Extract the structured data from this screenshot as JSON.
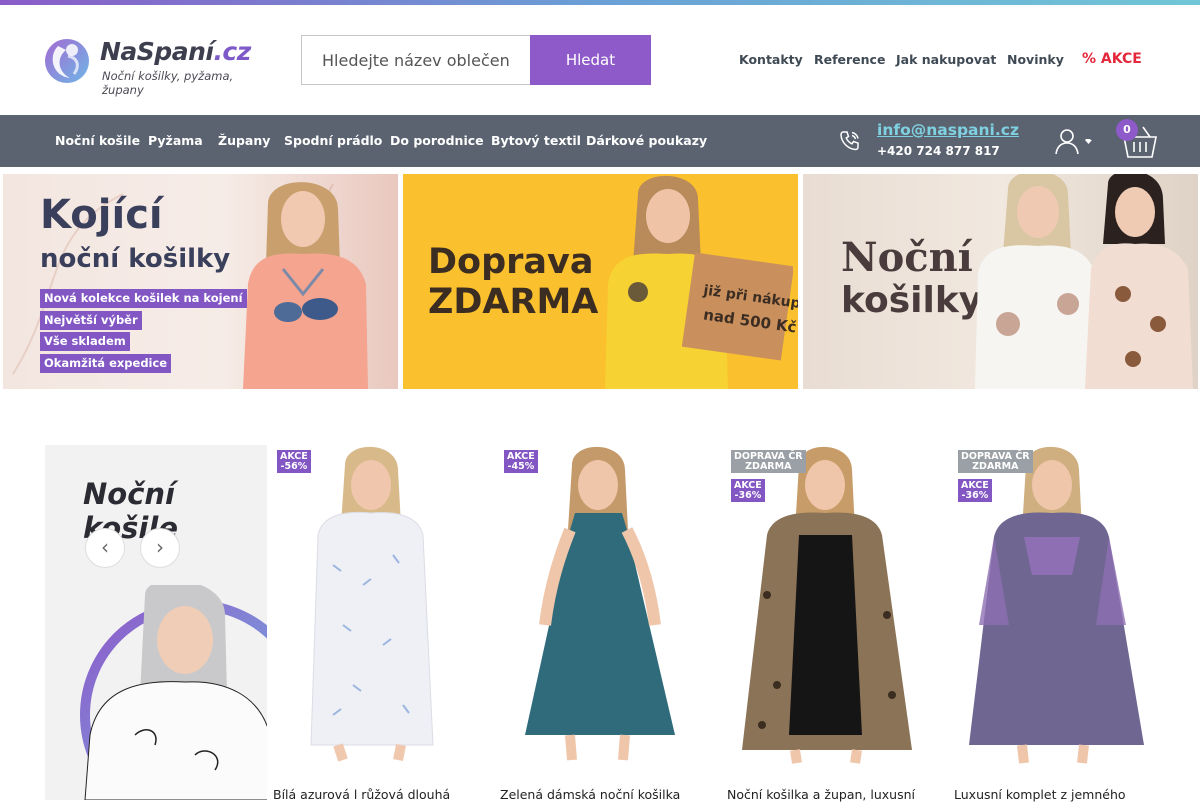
{
  "colors": {
    "accent": "#8e59c9",
    "navbar": "#5b6370",
    "sale": "#e4273b",
    "email": "#7fd0e0"
  },
  "logo": {
    "name": "NaSpaní",
    "domain": ".cz",
    "tagline": "Noční košilky, pyžama, župany"
  },
  "search": {
    "placeholder": "Hledejte název oblečení",
    "button_label": "Hledat"
  },
  "top_links": [
    "Kontakty",
    "Reference",
    "Jak nakupovat",
    "Novinky"
  ],
  "sale_link": {
    "symbol": "%",
    "label": "AKCE"
  },
  "categories": [
    "Noční košile",
    "Pyžama",
    "Župany",
    "Spodní prádlo",
    "Do porodnice",
    "Bytový textil",
    "Dárkové poukazy"
  ],
  "contact": {
    "email": "info@naspani.cz",
    "phone": "+420 724 877 817",
    "icon": "phone-icon"
  },
  "account": {
    "icon": "user-icon"
  },
  "cart": {
    "count": "0",
    "icon": "basket-icon"
  },
  "banners": [
    {
      "title_line1": "Kojící",
      "title_line2": "noční košilky",
      "bullets": [
        "Nová kolekce košilek na kojení",
        "Největší výběr",
        "Vše skladem",
        "Okamžitá expedice"
      ]
    },
    {
      "title_line1": "Doprava",
      "title_line2": "ZDARMA",
      "box_line1": "již při nákupu",
      "box_line2": "nad 500 Kč"
    },
    {
      "title_line1": "Noční",
      "title_line2": "košilky"
    }
  ],
  "promo": {
    "title_line1": "Noční",
    "title_line2": "košile",
    "prev": "‹",
    "next": "›"
  },
  "products": [
    {
      "badges": [
        {
          "type": "akce",
          "line1": "AKCE",
          "line2": "-56%"
        }
      ],
      "name": "Bílá azurová l růžová dlouhá",
      "dress_color": "#eef0f6",
      "pattern": "#9bb4e0"
    },
    {
      "badges": [
        {
          "type": "akce",
          "line1": "AKCE",
          "line2": "-45%"
        }
      ],
      "name": "Zelená dámská noční košilka",
      "dress_color": "#2f6b7a",
      "pattern": "#2f6b7a"
    },
    {
      "badges": [
        {
          "type": "ship",
          "line1": "DOPRAVA ČR",
          "line2": "ZDARMA"
        },
        {
          "type": "akce",
          "line1": "AKCE",
          "line2": "-36%"
        }
      ],
      "name": "Noční košilka a župan, luxusní",
      "dress_color": "#151515",
      "pattern": "#8a7356"
    },
    {
      "badges": [
        {
          "type": "ship",
          "line1": "DOPRAVA ČR",
          "line2": "ZDARMA"
        },
        {
          "type": "akce",
          "line1": "AKCE",
          "line2": "-36%"
        }
      ],
      "name": "Luxusní komplet z jemného",
      "dress_color": "#6f6791",
      "pattern": "#8f6fb3"
    }
  ]
}
